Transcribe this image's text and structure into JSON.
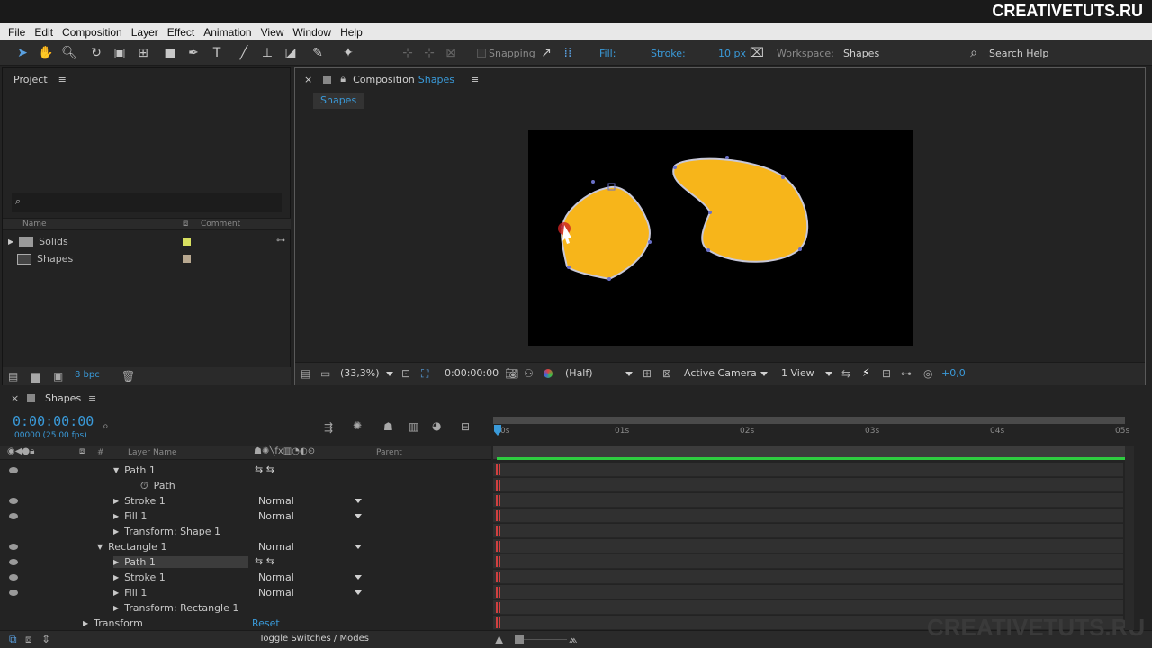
{
  "brand": "CREATIVETUTS.RU",
  "watermark": "CREATIVETUTS.RU",
  "menu": [
    "File",
    "Edit",
    "Composition",
    "Layer",
    "Effect",
    "Animation",
    "View",
    "Window",
    "Help"
  ],
  "toolbar": {
    "snapping": "Snapping",
    "fill_label": "Fill:",
    "fill_color": "#f7b51a",
    "stroke_label": "Stroke:",
    "stroke_width": "10 px",
    "workspace_label": "Workspace:",
    "workspace_value": "Shapes",
    "search_help": "Search Help"
  },
  "project": {
    "title": "Project",
    "col_name": "Name",
    "col_comment": "Comment",
    "items": [
      {
        "name": "Solids",
        "label_color": "#d8e060"
      },
      {
        "name": "Shapes",
        "label_color": "#b8a890"
      }
    ],
    "bpc": "8 bpc"
  },
  "composition": {
    "tab_prefix": "Composition",
    "tab_name": "Shapes",
    "subtab": "Shapes",
    "zoom": "(33,3%)",
    "timecode": "0:00:00:00",
    "resolution": "(Half)",
    "camera": "Active Camera",
    "views": "1 View",
    "exposure": "+0,0",
    "shape_fill": "#f7b51a"
  },
  "timeline": {
    "tab": "Shapes",
    "timecode": "0:00:00:00",
    "fps": "00000 (25.00 fps)",
    "col_layer_name": "Layer Name",
    "col_parent": "Parent",
    "col_hash": "#",
    "ruler": [
      "0s",
      "01s",
      "02s",
      "03s",
      "04s",
      "05s"
    ],
    "toggle": "Toggle Switches / Modes",
    "rows": [
      {
        "label": "Path 1",
        "mode": ""
      },
      {
        "label": "Path",
        "mode": ""
      },
      {
        "label": "Stroke 1",
        "mode": "Normal"
      },
      {
        "label": "Fill 1",
        "mode": "Normal"
      },
      {
        "label": "Transform: Shape 1",
        "mode": ""
      },
      {
        "label": "Rectangle 1",
        "mode": "Normal"
      },
      {
        "label": "Path 1",
        "mode": ""
      },
      {
        "label": "Stroke 1",
        "mode": "Normal"
      },
      {
        "label": "Fill 1",
        "mode": "Normal"
      },
      {
        "label": "Transform: Rectangle 1",
        "mode": ""
      },
      {
        "label": "Transform",
        "mode": "Reset"
      }
    ]
  }
}
